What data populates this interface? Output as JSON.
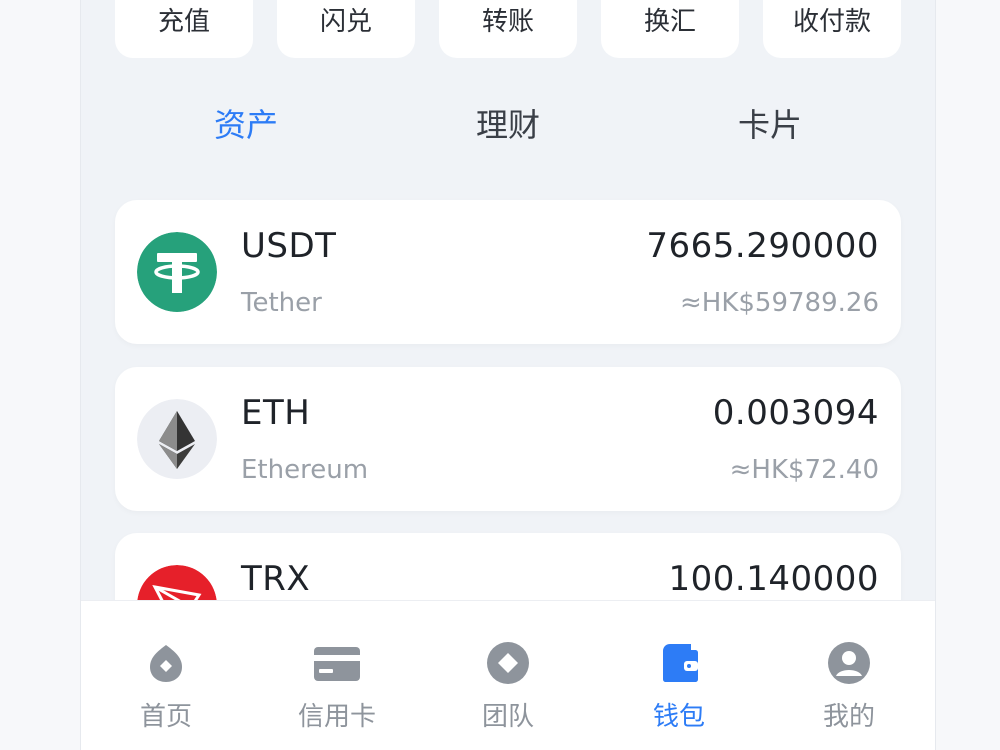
{
  "actions": [
    {
      "label": "充值",
      "name": "deposit-button"
    },
    {
      "label": "闪兑",
      "name": "flash-swap-button"
    },
    {
      "label": "转账",
      "name": "transfer-button"
    },
    {
      "label": "换汇",
      "name": "exchange-button"
    },
    {
      "label": "收付款",
      "name": "receive-pay-button"
    }
  ],
  "tabs": [
    {
      "label": "资产",
      "active": true
    },
    {
      "label": "理财",
      "active": false
    },
    {
      "label": "卡片",
      "active": false
    }
  ],
  "assets": [
    {
      "symbol": "USDT",
      "name": "Tether",
      "amount": "7665.290000",
      "fiat": "≈HK$59789.26",
      "icon": "usdt-icon"
    },
    {
      "symbol": "ETH",
      "name": "Ethereum",
      "amount": "0.003094",
      "fiat": "≈HK$72.40",
      "icon": "eth-icon"
    },
    {
      "symbol": "TRX",
      "name": "",
      "amount": "100.140000",
      "fiat": "",
      "icon": "trx-icon"
    }
  ],
  "nav": [
    {
      "label": "首页",
      "icon": "home-icon",
      "active": false
    },
    {
      "label": "信用卡",
      "icon": "credit-card-icon",
      "active": false
    },
    {
      "label": "团队",
      "icon": "team-icon",
      "active": false
    },
    {
      "label": "钱包",
      "icon": "wallet-icon",
      "active": true
    },
    {
      "label": "我的",
      "icon": "profile-icon",
      "active": false
    }
  ],
  "colors": {
    "accent": "#2d7cf6",
    "usdt": "#26a17b",
    "trx": "#e6202a",
    "nav_inactive": "#8e949c"
  }
}
